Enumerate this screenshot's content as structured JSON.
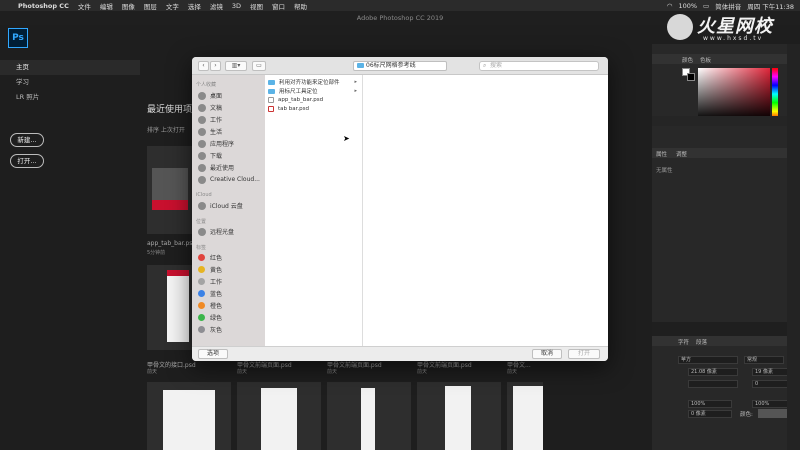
{
  "menubar": {
    "app_name": "Photoshop CC",
    "items": [
      "文件",
      "编辑",
      "图像",
      "图层",
      "文字",
      "选择",
      "滤镜",
      "3D",
      "视图",
      "窗口",
      "帮助"
    ],
    "battery": "100%",
    "input_method": "简体拼音",
    "clock": "周四 下午11:38"
  },
  "window": {
    "title": "Adobe Photoshop CC 2019"
  },
  "watermark": {
    "brand": "火星网校",
    "url": "www.hxsd.tv"
  },
  "home": {
    "logo": "Ps",
    "nav": [
      "主页",
      "学习",
      "LR 照片"
    ],
    "new_button": "新建...",
    "open_button": "打开...",
    "recent_title": "最近使用项",
    "sort_label": "排序  上次打开",
    "recent_files": [
      {
        "name": "app_tab_bar.psd",
        "time": "5分钟前"
      },
      {
        "name": "甲骨文的接口.psd",
        "time": "前天"
      },
      {
        "name": "甲骨文前端页面.psd",
        "time": "前天"
      },
      {
        "name": "甲骨文前端页面.psd",
        "time": "前天"
      },
      {
        "name": "甲骨文前端页面.psd",
        "time": "前天"
      },
      {
        "name": "甲骨文...",
        "time": "前天"
      }
    ]
  },
  "panels": {
    "color_tabs": [
      "颜色",
      "色板"
    ],
    "props_tabs": [
      "属性",
      "调整"
    ],
    "props_empty": "无属性",
    "char_tabs": [
      "字符",
      "段落"
    ],
    "font_family": "苹方",
    "font_style": "常规",
    "font_size": "21.08 像素",
    "leading": "19 像素",
    "kerning": "",
    "tracking": "0",
    "vscale": "100%",
    "hscale": "100%",
    "baseline": "0 像素",
    "color_label": "颜色:"
  },
  "dialog": {
    "path": "06标尺网格参考线",
    "search_placeholder": "搜索",
    "sidebar": {
      "personal_head": "个人收藏",
      "personal": [
        "桌面",
        "文稿",
        "工作",
        "生活",
        "应用程序",
        "下载",
        "最近使用",
        "Creative Cloud..."
      ],
      "icloud_head": "iCloud",
      "icloud": [
        "iCloud 云盘"
      ],
      "location_head": "位置",
      "locations": [
        "远程光盘"
      ],
      "tags_head": "标签",
      "tags": [
        {
          "name": "红色",
          "color": "#e0443e"
        },
        {
          "name": "黄色",
          "color": "#e6b422"
        },
        {
          "name": "工作",
          "color": "#a3a3a3"
        },
        {
          "name": "蓝色",
          "color": "#3b82e6"
        },
        {
          "name": "橙色",
          "color": "#f08a24"
        },
        {
          "name": "绿色",
          "color": "#3bb54a"
        },
        {
          "name": "灰色",
          "color": "#8e8e93"
        }
      ]
    },
    "files": [
      {
        "name": "利用对齐功能来定位部件",
        "type": "folder"
      },
      {
        "name": "用标尺工具定位",
        "type": "folder"
      },
      {
        "name": "app_tab_bar.psd",
        "type": "doc"
      },
      {
        "name": "tab bar.psd",
        "type": "doc"
      }
    ],
    "options_button": "选项",
    "cancel_button": "取消",
    "open_button": "打开"
  }
}
